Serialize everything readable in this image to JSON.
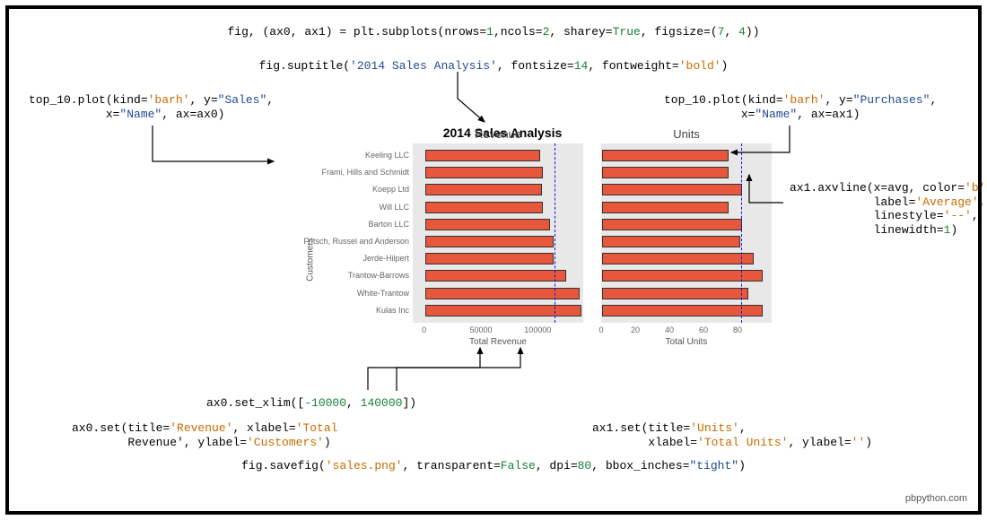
{
  "footer": "pbpython.com",
  "code": {
    "subplots": {
      "p1": "fig, (ax0, ax1) = plt.subplots(nrows=",
      "v1": "1",
      "p2": ",ncols=",
      "v2": "2",
      "p3": ", sharey=",
      "v3": "True",
      "p4": ", figsize=(",
      "v4": "7",
      "p5": ", ",
      "v5": "4",
      "p6": "))"
    },
    "suptitle": {
      "p1": "fig.suptitle(",
      "v1": "'2014 Sales Analysis'",
      "p2": ", fontsize=",
      "v2": "14",
      "p3": ", fontweight=",
      "v3": "'bold'",
      "p4": ")"
    },
    "plotleft": {
      "p1": "top_10.plot(kind=",
      "v1": "'barh'",
      "p2": ", y=",
      "v2": "\"Sales\"",
      "p3": ",",
      "p4": "           x=",
      "v3": "\"Name\"",
      "p5": ", ax=ax0)"
    },
    "plotright": {
      "p1": "top_10.plot(kind=",
      "v1": "'barh'",
      "p2": ", y=",
      "v2": "\"Purchases\"",
      "p3": ",",
      "p4": "           x=",
      "v3": "\"Name\"",
      "p5": ", ax=ax1)"
    },
    "axvline": {
      "p1": "ax1.axvline(x=avg, color=",
      "v1": "'b'",
      "p2": ",",
      "p3": "            label=",
      "v2": "'Average'",
      "p4": ",",
      "p5": "            linestyle=",
      "v3": "'--'",
      "p6": ",",
      "p7": "            linewidth=",
      "v4": "1",
      "p8": ")"
    },
    "xlim": {
      "p1": "ax0.set_xlim([",
      "v1": "-10000",
      "p2": ", ",
      "v2": "140000",
      "p3": "])"
    },
    "setleft": {
      "p1": "ax0.set(title=",
      "v1": "'Revenue'",
      "p2": ", xlabel=",
      "v2": "'Total",
      "p3": "        Revenue'",
      "p4": ", ylabel=",
      "v3": "'Customers'",
      "p5": ")"
    },
    "setright": {
      "p1": "ax1.set(title=",
      "v1": "'Units'",
      "p2": ",",
      "p3": "        xlabel=",
      "v2": "'Total Units'",
      "p4": ", ylabel=",
      "v3": "''",
      "p5": ")"
    },
    "savefig": {
      "p1": "fig.savefig(",
      "v1": "'sales.png'",
      "p2": ", transparent=",
      "v2": "False",
      "p3": ", dpi=",
      "v3": "80",
      "p4": ", bbox_inches=",
      "v4": "\"tight\"",
      "p5": ")"
    }
  },
  "chart_data": [
    {
      "type": "barh",
      "suptitle": "2014 Sales Analysis",
      "title": "Revenue",
      "xlabel": "Total Revenue",
      "ylabel": "Customers",
      "xlim": [
        -10000,
        140000
      ],
      "xticks": [
        0,
        50000,
        100000
      ],
      "categories": [
        "Keeling LLC",
        "Frami, Hills and Schmidt",
        "Koepp Ltd",
        "Will LLC",
        "Barton LLC",
        "Fritsch, Russel and Anderson",
        "Jerde-Hilpert",
        "Trantow-Barrows",
        "White-Trantow",
        "Kulas Inc"
      ],
      "values": [
        101000,
        104000,
        103000,
        104000,
        110000,
        113000,
        113000,
        124000,
        136000,
        138000
      ],
      "avg": 115000
    },
    {
      "type": "barh",
      "title": "Units",
      "xlabel": "Total Units",
      "ylabel": "",
      "xlim": [
        0,
        100
      ],
      "xticks": [
        0,
        20,
        40,
        60,
        80
      ],
      "categories": [
        "Keeling LLC",
        "Frami, Hills and Schmidt",
        "Koepp Ltd",
        "Will LLC",
        "Barton LLC",
        "Fritsch, Russel and Anderson",
        "Jerde-Hilpert",
        "Trantow-Barrows",
        "White-Trantow",
        "Kulas Inc"
      ],
      "values": [
        74,
        74,
        82,
        74,
        82,
        81,
        89,
        94,
        86,
        94
      ],
      "avg": 82
    }
  ]
}
